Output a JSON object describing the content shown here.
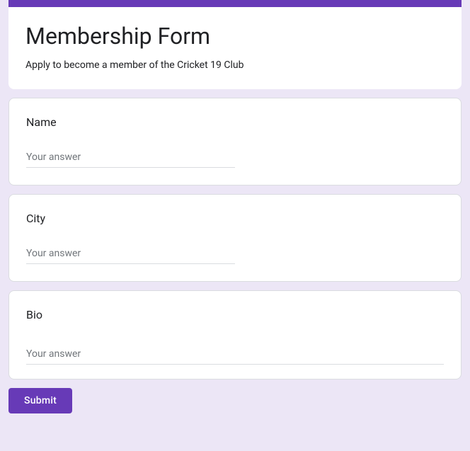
{
  "header": {
    "title": "Membership Form",
    "description": "Apply to become a member of the Cricket 19 Club"
  },
  "questions": {
    "name": {
      "label": "Name",
      "placeholder": "Your answer"
    },
    "city": {
      "label": "City",
      "placeholder": "Your answer"
    },
    "bio": {
      "label": "Bio",
      "placeholder": "Your answer"
    }
  },
  "actions": {
    "submit_label": "Submit"
  }
}
